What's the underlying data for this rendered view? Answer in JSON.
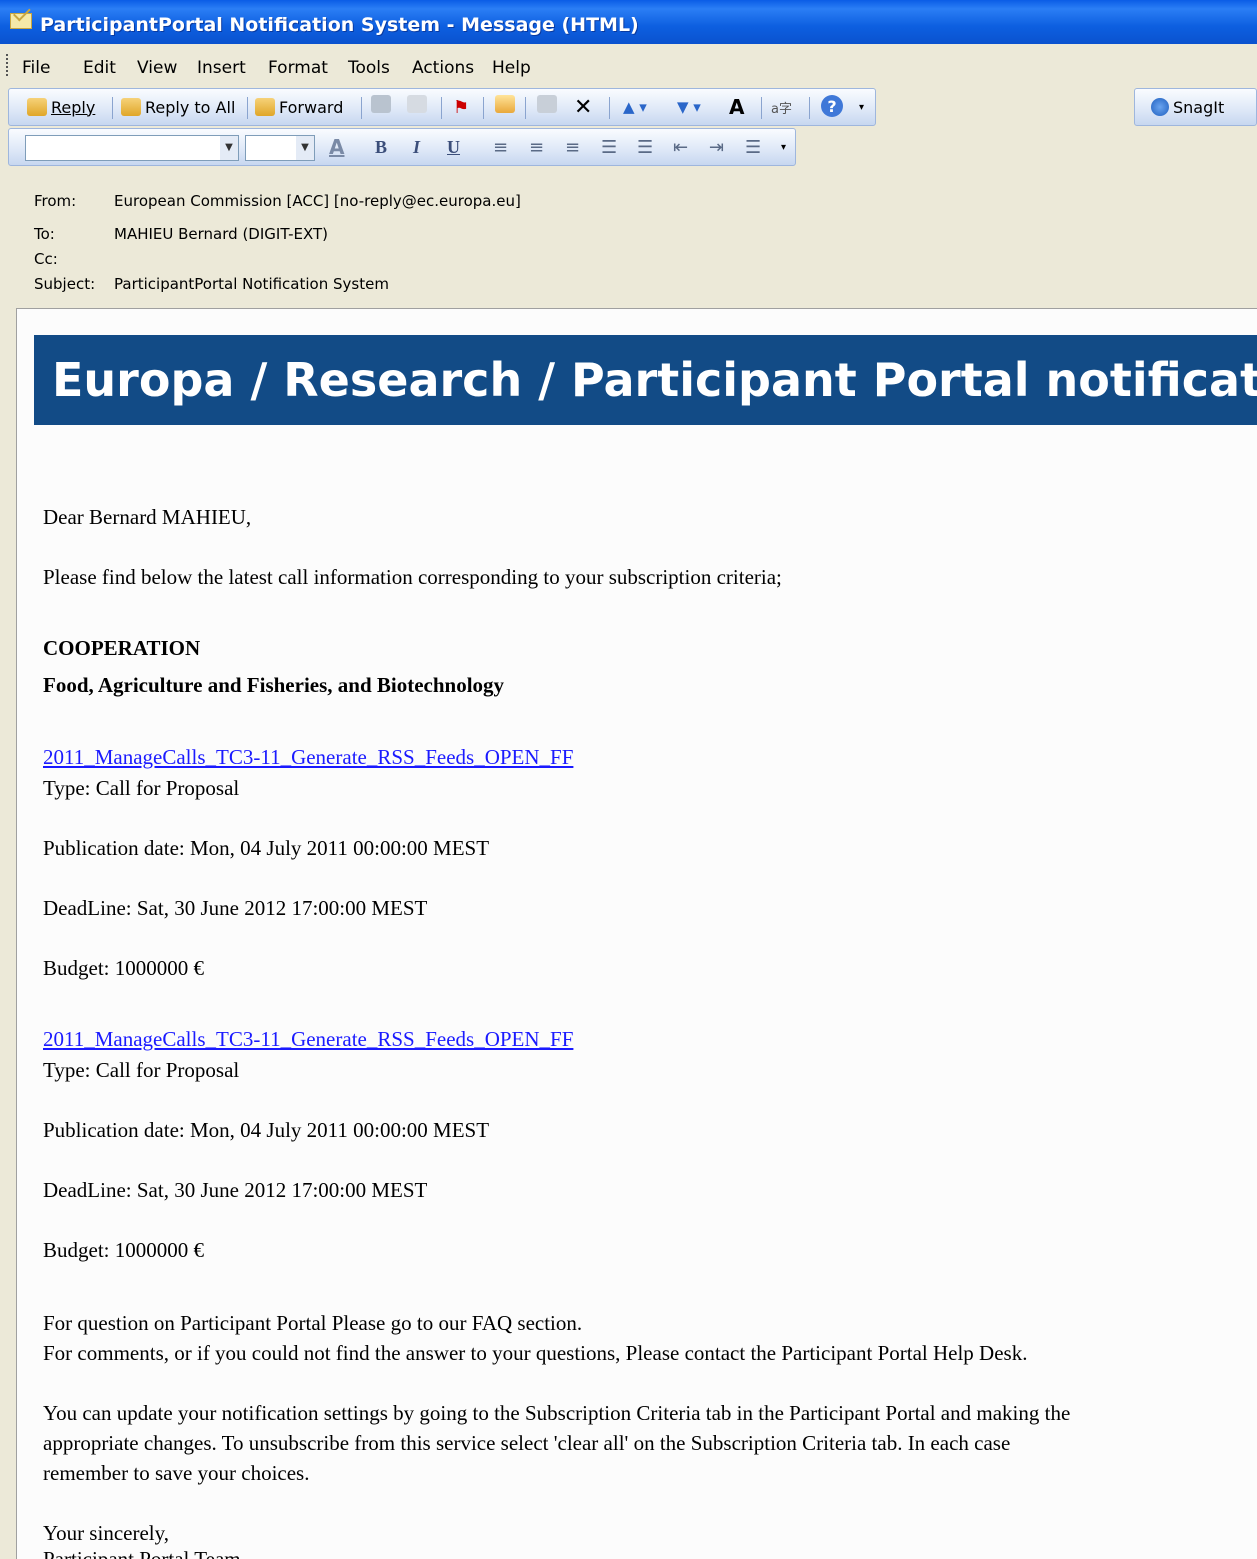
{
  "window": {
    "title": "ParticipantPortal Notification System - Message (HTML)"
  },
  "menu": [
    "File",
    "Edit",
    "View",
    "Insert",
    "Format",
    "Tools",
    "Actions",
    "Help"
  ],
  "toolbar": {
    "reply": "Reply",
    "reply_all": "Reply to All",
    "forward": "Forward",
    "snagit": "SnagIt"
  },
  "format_toolbar": {
    "font": "",
    "size": ""
  },
  "headers": {
    "from_label": "From:",
    "from": "European Commission [ACC] [no-reply@ec.europa.eu]",
    "to_label": "To:",
    "to": "MAHIEU Bernard (DIGIT-EXT)",
    "cc_label": "Cc:",
    "cc": "",
    "subject_label": "Subject:",
    "subject": "ParticipantPortal Notification System"
  },
  "message": {
    "banner": "Europa / Research / Participant Portal notification",
    "greeting": "Dear Bernard MAHIEU,",
    "intro": "Please find below the latest call information corresponding to your subscription criteria;",
    "programme": "COOPERATION",
    "theme": "Food, Agriculture and Fisheries, and Biotechnology",
    "calls": [
      {
        "link": "2011_ManageCalls_TC3-11_Generate_RSS_Feeds_OPEN_FF",
        "type": "Type: Call for Proposal",
        "publication": "Publication date: Mon, 04 July 2011 00:00:00 MEST",
        "deadline": "DeadLine: Sat, 30 June 2012 17:00:00 MEST",
        "budget": "Budget: 1000000 €"
      },
      {
        "link": "2011_ManageCalls_TC3-11_Generate_RSS_Feeds_OPEN_FF",
        "type": "Type: Call for Proposal",
        "publication": "Publication date: Mon, 04 July 2011 00:00:00 MEST",
        "deadline": "DeadLine: Sat, 30 June 2012 17:00:00 MEST",
        "budget": "Budget: 1000000 €"
      }
    ],
    "faq": "For question on Participant Portal Please go to our FAQ section.",
    "helpdesk": "For comments, or if you could not find the answer to your questions, Please contact the Participant Portal Help Desk.",
    "update_1": "You can update your notification settings by going to the Subscription Criteria tab in the Participant Portal and making the",
    "update_2": "appropriate changes. To unsubscribe from this service select 'clear all' on the Subscription Criteria tab. In each case",
    "update_3": "remember to save your choices.",
    "closing": "Your sincerely,",
    "signature": "Participant Portal Team"
  }
}
